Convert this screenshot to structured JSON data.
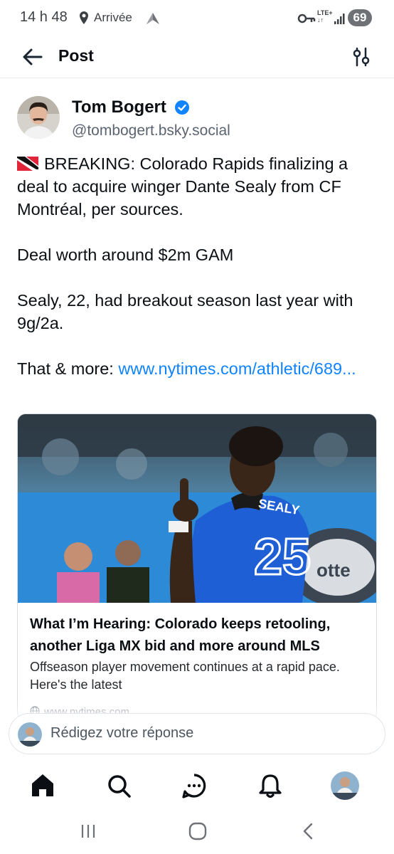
{
  "status_bar": {
    "time": "14 h 48",
    "destination": "Arrivée",
    "network": "LTE+",
    "battery": "69"
  },
  "header": {
    "title": "Post"
  },
  "post": {
    "author_name": "Tom Bogert",
    "handle": "@tombogert.bsky.social",
    "paragraphs": [
      "BREAKING: Colorado Rapids finalizing a deal to acquire winger Dante Sealy from CF Montréal, per sources.",
      "Deal worth around $2m GAM",
      "Sealy, 22, had breakout season last year with 9g/2a."
    ],
    "link_prefix": "That & more: ",
    "link_text": "www.nytimes.com/athletic/689...",
    "flag": "trinidad-and-tobago-flag"
  },
  "card": {
    "title": "What I’m Hearing: Colorado keeps retooling, another Liga MX bid and more around MLS",
    "description": "Offseason player movement continues at a rapid pace. Here's the latest",
    "domain": "www.nytimes.com",
    "jersey_name": "SEALY",
    "jersey_number": "25"
  },
  "reply": {
    "placeholder": "Rédigez votre réponse"
  },
  "bottom_nav": {
    "items": [
      "home-icon",
      "search-icon",
      "chat-icon",
      "bell-icon",
      "profile-avatar"
    ]
  },
  "colors": {
    "accent": "#1083fe",
    "text": "#0b0f14",
    "muted": "#5b6470",
    "jersey_blue": "#1f5fd6"
  }
}
